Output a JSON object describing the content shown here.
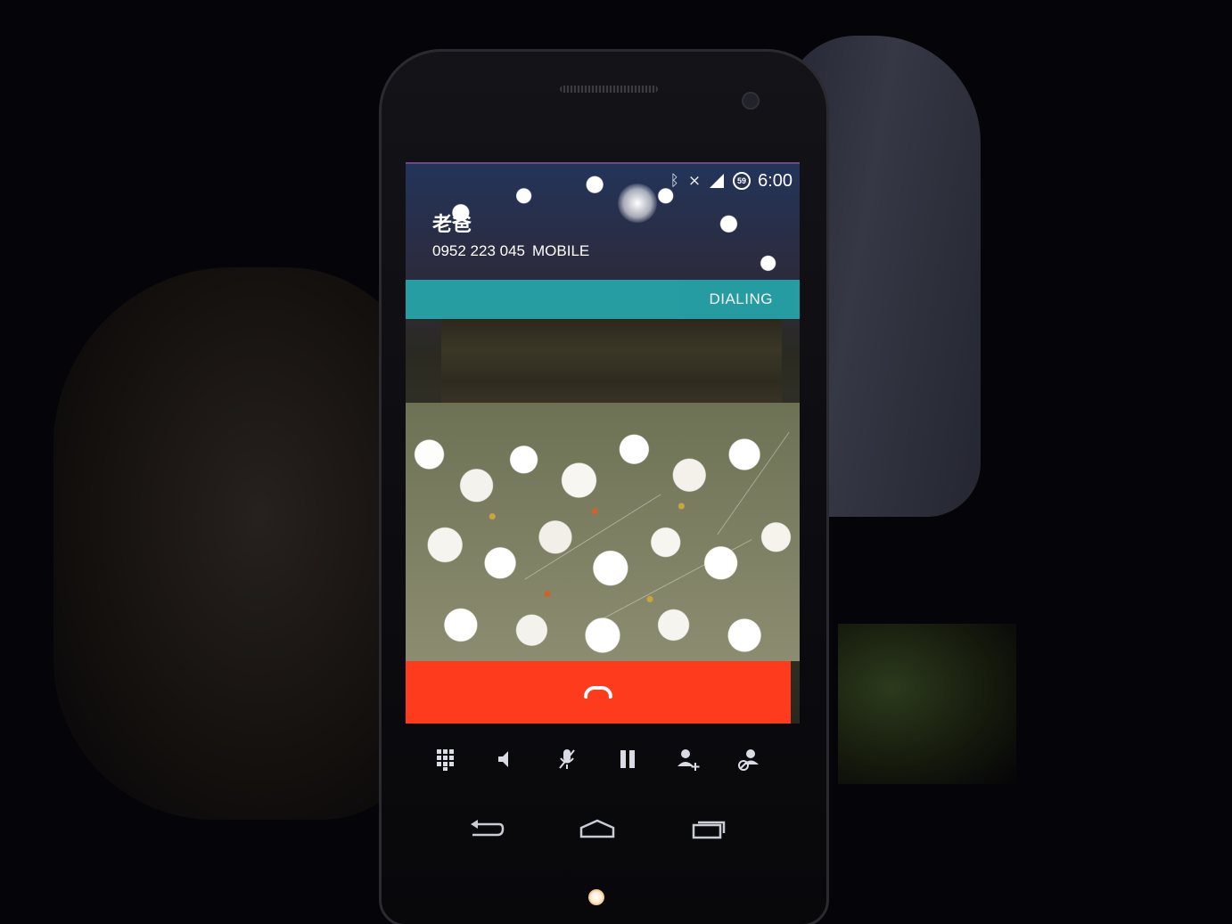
{
  "status_bar": {
    "battery": "59",
    "time": "6:00",
    "icons": [
      "bluetooth-icon",
      "vibrate-icon",
      "signal-icon",
      "battery-icon"
    ]
  },
  "caller": {
    "name": "老爸",
    "number": "0952 223 045",
    "type": "MOBILE"
  },
  "call": {
    "status": "DIALING"
  },
  "controls": [
    "dialpad-icon",
    "speaker-icon",
    "mute-icon",
    "hold-icon",
    "add-call-icon",
    "merge-call-icon"
  ],
  "navigation": [
    "back-icon",
    "home-icon",
    "recents-icon"
  ],
  "colors": {
    "status_strip": "#25a3a8",
    "end_call": "#ff3b1e",
    "text": "#ffffff"
  }
}
